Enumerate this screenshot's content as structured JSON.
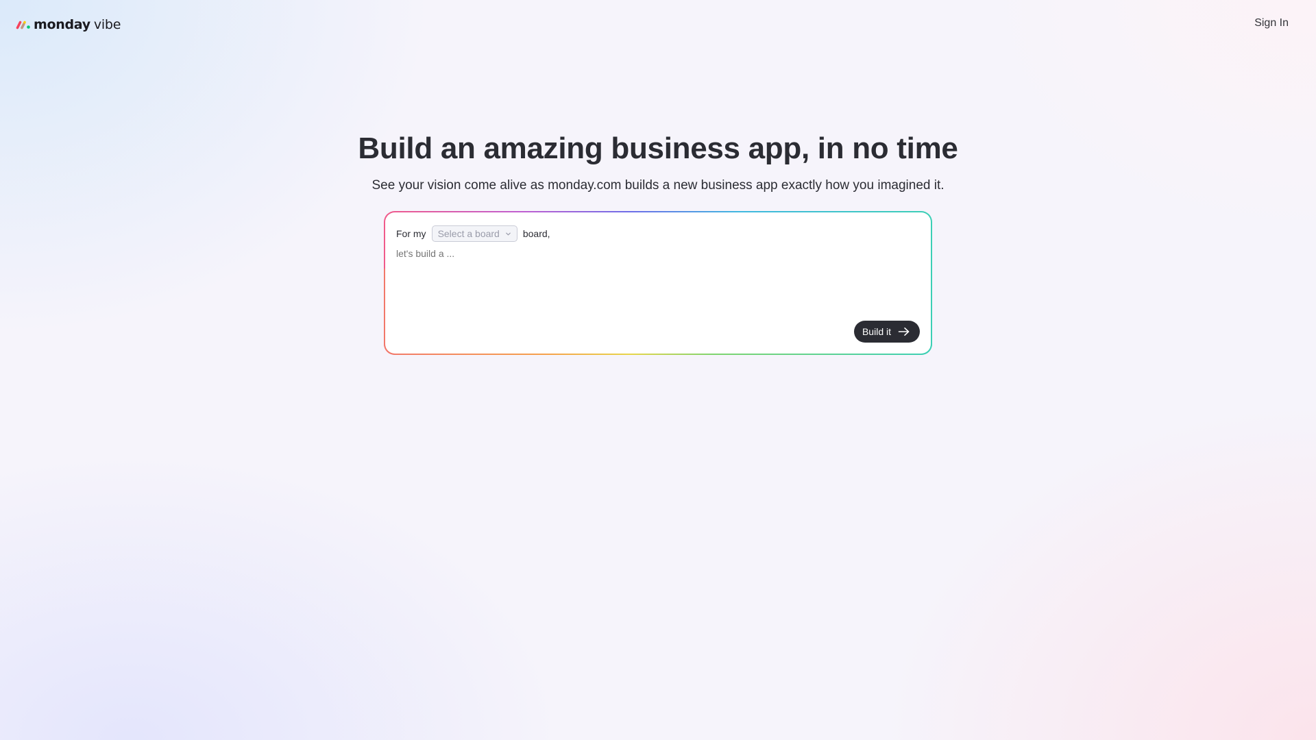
{
  "header": {
    "logo_word": "monday",
    "logo_sub": "vibe",
    "logo_icon": "monday-logo-icon",
    "sign_in_label": "Sign In"
  },
  "hero": {
    "title": "Build an amazing business app, in no time",
    "subtitle": "See your vision come alive as monday.com builds a new business app exactly how you imagined it."
  },
  "prompt": {
    "prefix": "For my",
    "board_select": {
      "placeholder": "Select a board",
      "icon": "chevron-down-icon"
    },
    "suffix": "board,",
    "input_placeholder": "let's build a ...",
    "input_value": "",
    "build_label": "Build it",
    "build_icon": "arrow-right-icon"
  },
  "colors": {
    "text": "#2b2c33",
    "button_bg": "#2b2c33",
    "button_text": "#ffffff",
    "logo_red": "#f6425b",
    "logo_yellow": "#ffcc00",
    "logo_green": "#00ca72",
    "border_gradient": [
      "#f05a8a",
      "#6d6de8",
      "#3ccfb5",
      "#f5a24b"
    ]
  }
}
